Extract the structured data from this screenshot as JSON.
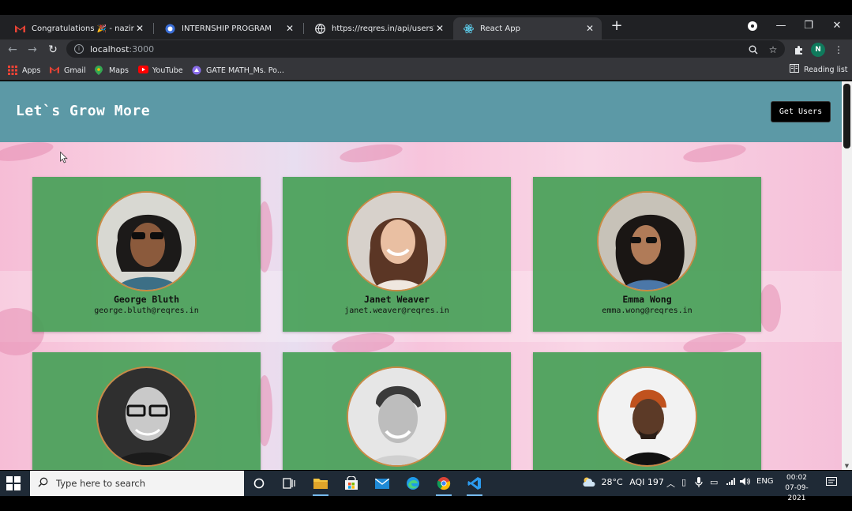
{
  "browser": {
    "tabs": [
      {
        "title": "Congratulations 🎉 - naziransari",
        "icon": "gmail-icon",
        "active": false
      },
      {
        "title": "INTERNSHIP PROGRAM",
        "icon": "circle-logo-icon",
        "active": false
      },
      {
        "title": "https://reqres.in/api/users?page=",
        "icon": "globe-icon",
        "active": false
      },
      {
        "title": "React App",
        "icon": "react-icon",
        "active": true
      }
    ],
    "address": {
      "host": "localhost",
      "port": ":3000"
    },
    "profile_initial": "N",
    "bookmarks": [
      {
        "label": "Apps",
        "icon": "apps-grid-icon"
      },
      {
        "label": "Gmail",
        "icon": "gmail-icon"
      },
      {
        "label": "Maps",
        "icon": "maps-pin-icon"
      },
      {
        "label": "YouTube",
        "icon": "youtube-icon"
      },
      {
        "label": "GATE MATH_Ms. Po...",
        "icon": "bookmark-site-icon"
      }
    ],
    "reading_list": "Reading list"
  },
  "page": {
    "brand": "Let`s Grow More",
    "get_users_label": "Get Users",
    "users": [
      {
        "name": "George Bluth",
        "email": "george.bluth@reqres.in"
      },
      {
        "name": "Janet Weaver",
        "email": "janet.weaver@reqres.in"
      },
      {
        "name": "Emma Wong",
        "email": "emma.wong@reqres.in"
      },
      {
        "name": "",
        "email": ""
      },
      {
        "name": "",
        "email": ""
      },
      {
        "name": "",
        "email": ""
      }
    ]
  },
  "taskbar": {
    "search_placeholder": "Type here to search",
    "weather": "28°C",
    "aqi": "AQI 197",
    "language": "ENG",
    "time": "00:02",
    "date": "07-09-2021"
  },
  "colors": {
    "header": "#5c99a6",
    "card": "#48a058",
    "photo_border": "#c98a45"
  }
}
